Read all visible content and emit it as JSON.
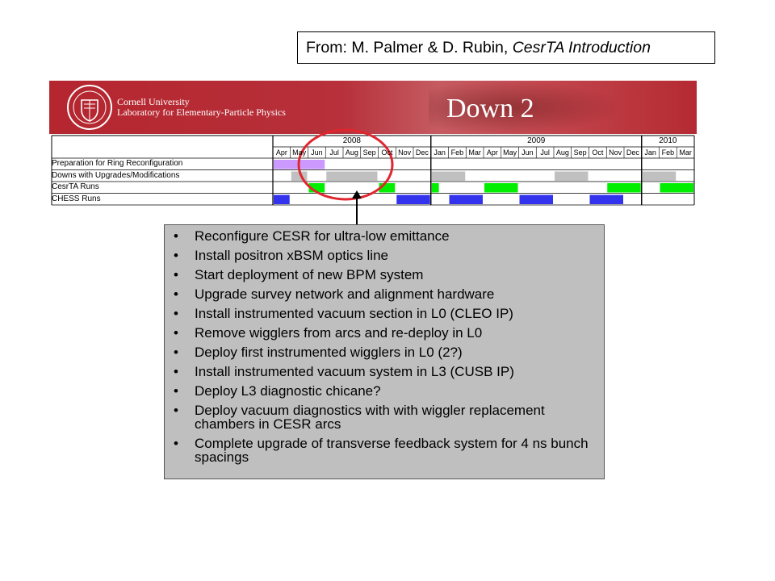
{
  "citation": {
    "prefix": "From: M. Palmer & D. Rubin, ",
    "title": "CesrTA Introduction"
  },
  "banner": {
    "university": "Cornell University",
    "lab": "Laboratory for Elementary-Particle Physics",
    "heading": "Down 2"
  },
  "schedule": {
    "years": [
      "2008",
      "2009",
      "2010"
    ],
    "months": [
      "Apr",
      "May",
      "Jun",
      "Jul",
      "Aug",
      "Sep",
      "Oct",
      "Nov",
      "Dec",
      "Jan",
      "Feb",
      "Mar",
      "Apr",
      "May",
      "Jun",
      "Jul",
      "Aug",
      "Sep",
      "Oct",
      "Nov",
      "Dec",
      "Jan",
      "Feb",
      "Mar"
    ],
    "rows": [
      {
        "label": "Preparation for Ring Reconfiguration",
        "color": "#cc99ff",
        "bars": [
          {
            "start": 0,
            "end": 3
          }
        ]
      },
      {
        "label": "Downs with Upgrades/Modifications",
        "color": "#c0c0c0",
        "bars": [
          {
            "start": 1,
            "end": 2
          },
          {
            "start": 3,
            "end": 6
          },
          {
            "start": 9,
            "end": 11
          },
          {
            "start": 16,
            "end": 18
          },
          {
            "start": 21,
            "end": 23
          }
        ]
      },
      {
        "label": "CesrTA Runs",
        "color": "#00ee00",
        "bars": [
          {
            "start": 2,
            "end": 3
          },
          {
            "start": 6,
            "end": 7
          },
          {
            "start": 9,
            "end": 9.5
          },
          {
            "start": 12,
            "end": 14
          },
          {
            "start": 19,
            "end": 21
          },
          {
            "start": 22,
            "end": 24
          }
        ]
      },
      {
        "label": "CHESS Runs",
        "color": "#3333ee",
        "bars": [
          {
            "start": 0,
            "end": 1
          },
          {
            "start": 7,
            "end": 9
          },
          {
            "start": 10,
            "end": 12
          },
          {
            "start": 14,
            "end": 16
          },
          {
            "start": 18,
            "end": 20
          }
        ]
      }
    ]
  },
  "bullets": [
    "Reconfigure CESR for ultra-low emittance",
    "Install positron xBSM optics line",
    "Start deployment of new BPM system",
    "Upgrade survey network and alignment hardware",
    "Install instrumented vacuum section in L0 (CLEO IP)",
    "Remove wigglers from arcs and re-deploy in L0",
    "Deploy first instrumented wigglers in L0 (2?)",
    "Install instrumented vacuum system in L3 (CUSB IP)",
    "Deploy L3 diagnostic chicane?",
    "Deploy vacuum diagnostics with with wiggler replacement chambers in CESR arcs",
    "Complete upgrade of transverse feedback system for 4 ns bunch spacings"
  ],
  "bullet_symbol": "•",
  "colors": {
    "banner_red": "#b5262f",
    "highlight_circle": "#e0262f",
    "box_gray": "#bfbfbf"
  }
}
